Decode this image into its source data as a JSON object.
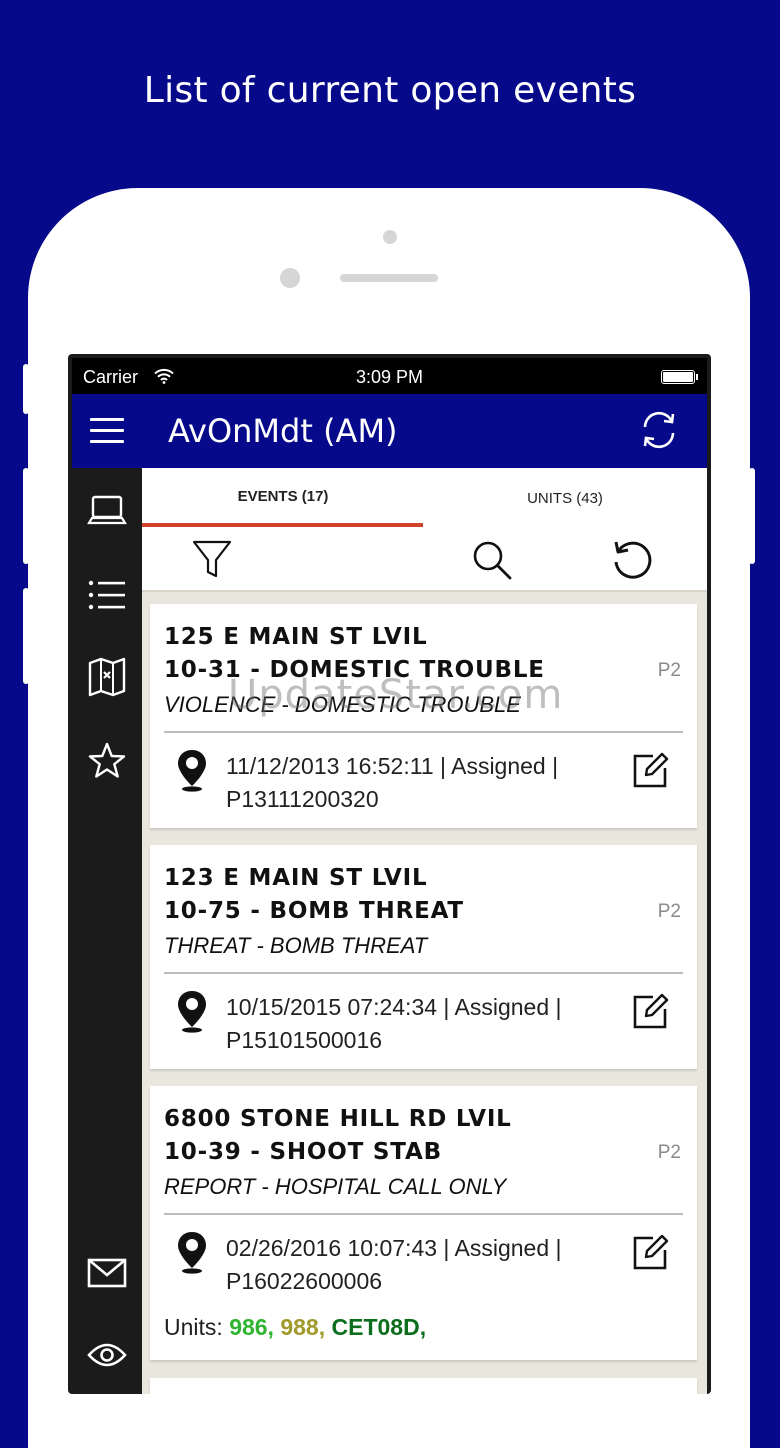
{
  "headline": "List of current open events",
  "status_bar": {
    "carrier": "Carrier",
    "time": "3:09 PM"
  },
  "app_bar": {
    "title": "AvOnMdt (AM)"
  },
  "tabs": [
    {
      "label": "EVENTS (17)",
      "selected": true
    },
    {
      "label": "UNITS (43)",
      "selected": false
    }
  ],
  "nav_icons": [
    "laptop-icon",
    "list-icon",
    "map-icon",
    "star-icon",
    "mail-icon",
    "eye-icon"
  ],
  "toolbar_icons": [
    "filter-icon",
    "search-icon",
    "undo-icon"
  ],
  "events": [
    {
      "address": "125 E MAIN ST LVIL",
      "code": "10-31 - DOMESTIC TROUBLE",
      "description": "VIOLENCE - DOMESTIC TROUBLE",
      "priority": "P2",
      "info_line1": "11/12/2013 16:52:11 | Assigned |",
      "info_line2": "P13111200320"
    },
    {
      "address": "123 E MAIN ST LVIL",
      "code": "10-75 - BOMB THREAT",
      "description": "THREAT - BOMB THREAT",
      "priority": "P2",
      "info_line1": "10/15/2015 07:24:34 | Assigned |",
      "info_line2": "P15101500016"
    },
    {
      "address": "6800 STONE HILL RD LVIL",
      "code": "10-39 - SHOOT STAB",
      "description": "REPORT - HOSPITAL CALL ONLY",
      "priority": "P2",
      "info_line1": "02/26/2016 10:07:43 | Assigned |",
      "info_line2": "P16022600006",
      "units_label": "Units:",
      "units": [
        {
          "name": "986,",
          "color": "#2fb52f"
        },
        {
          "name": "988,",
          "color": "#a09a2a"
        },
        {
          "name": "CET08D,",
          "color": "#0c6e1c"
        }
      ]
    }
  ],
  "watermark": "UpdateStar.com",
  "colors": {
    "brand_blue": "#060a8a",
    "tab_indicator": "#d0422a"
  }
}
